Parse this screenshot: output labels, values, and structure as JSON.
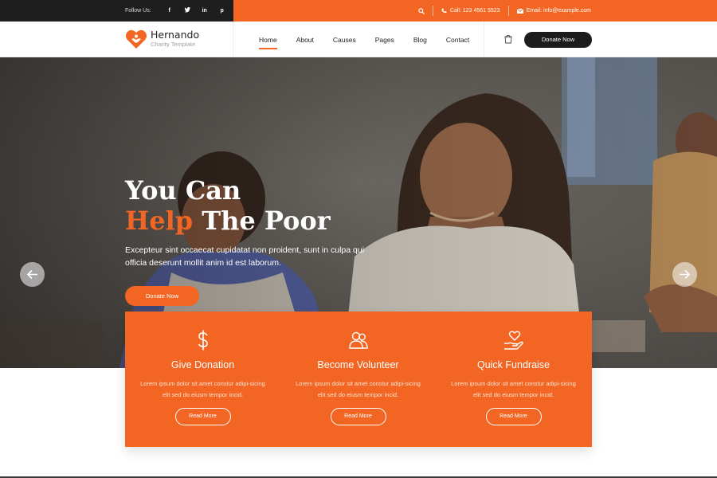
{
  "topbar": {
    "follow_label": "Follow Us:",
    "social": [
      {
        "icon": "facebook-icon",
        "glyph": "f"
      },
      {
        "icon": "twitter-icon",
        "glyph": "t"
      },
      {
        "icon": "linkedin-icon",
        "glyph": "in"
      },
      {
        "icon": "pinterest-icon",
        "glyph": "p"
      }
    ],
    "call": "Call: 123 4561 5523",
    "email": "Email: info@example.com"
  },
  "logo": {
    "name": "Hernando",
    "subtitle": "Charity Template"
  },
  "nav": {
    "items": [
      {
        "label": "Home",
        "active": true
      },
      {
        "label": "About",
        "active": false
      },
      {
        "label": "Causes",
        "active": false
      },
      {
        "label": "Pages",
        "active": false
      },
      {
        "label": "Blog",
        "active": false
      },
      {
        "label": "Contact",
        "active": false
      }
    ],
    "donate_label": "Donate Now"
  },
  "hero": {
    "title_line1": "You Can",
    "title_accent": "Help",
    "title_rest": "The Poor",
    "description": "Excepteur sint occaecat cupidatat non proident, sunt in culpa qui officia deserunt mollit anim id est laborum.",
    "button_label": "Donate Now"
  },
  "features": [
    {
      "icon": "dollar-icon",
      "title": "Give Donation",
      "text": "Lorem ipsum dolor sit amet constur adipi-sicing elit sed do eiusm tempor incid.",
      "button": "Read More"
    },
    {
      "icon": "volunteer-icon",
      "title": "Become Volunteer",
      "text": "Lorem ipsum dolor sit amet constur adipi-sicing elit sed do eiusm tempor incid.",
      "button": "Read More"
    },
    {
      "icon": "heart-hand-icon",
      "title": "Quick Fundraise",
      "text": "Lorem ipsum dolor sit amet constur adipi-sicing elit sed do eiusm tempor incid.",
      "button": "Read More"
    }
  ],
  "colors": {
    "accent": "#f26522",
    "dark": "#1e1e1e"
  }
}
